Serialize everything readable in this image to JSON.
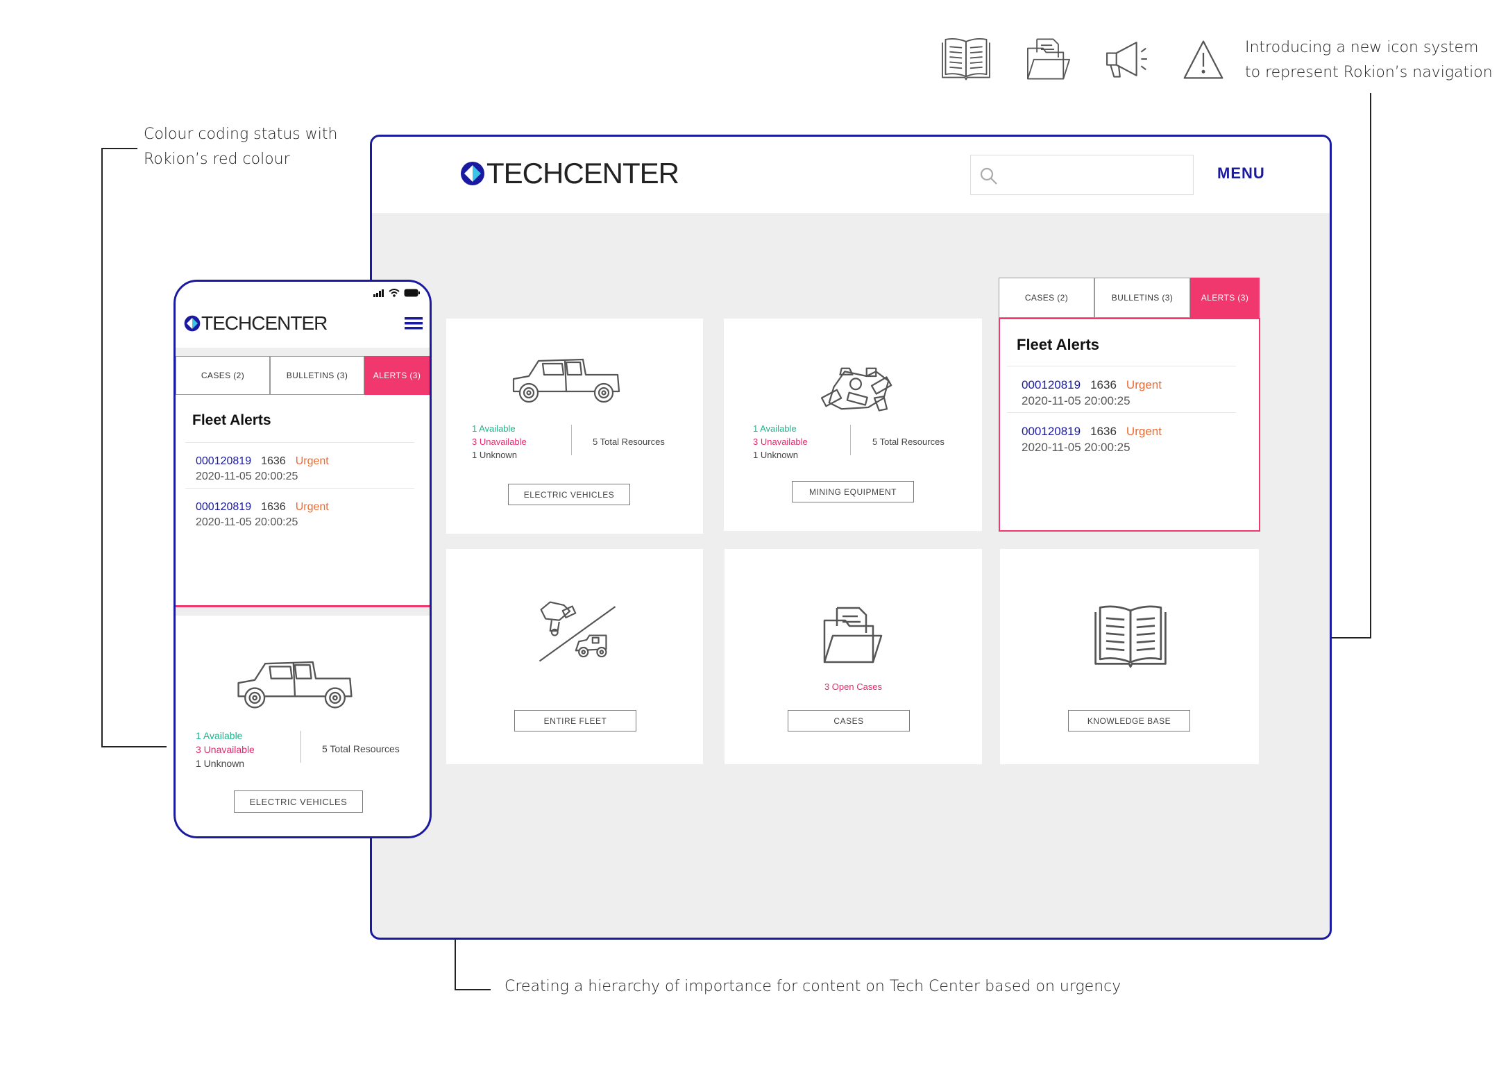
{
  "annotations": {
    "top_right": [
      "Introducing a new icon system",
      "to represent Rokion’s navigation"
    ],
    "left": [
      "Colour coding status with",
      "Rokion’s red colour"
    ],
    "bottom": "Creating a hierarchy of importance for content on Tech Center based on urgency"
  },
  "icon_legend": [
    "book-icon",
    "folder-icon",
    "megaphone-icon",
    "warning-icon"
  ],
  "brand": {
    "logo_text": "TECHCENTER",
    "accent": "#1a1aa0",
    "alert": "#f0386e",
    "available": "#1fb38a",
    "urgent": "#f06a30"
  },
  "desktop": {
    "search": {
      "placeholder": ""
    },
    "menu_label": "MENU",
    "cards": {
      "ev": {
        "available": "1 Available",
        "unavailable": "3 Unavailable",
        "unknown": "1 Unknown",
        "total": "5 Total Resources",
        "button": "ELECTRIC VEHICLES"
      },
      "mining": {
        "available": "1 Available",
        "unavailable": "3 Unavailable",
        "unknown": "1 Unknown",
        "total": "5 Total Resources",
        "button": "MINING EQUIPMENT"
      },
      "fleet": {
        "button": "ENTIRE FLEET"
      },
      "cases": {
        "status": "3 Open Cases",
        "button": "CASES"
      },
      "kb": {
        "button": "KNOWLEDGE BASE"
      }
    },
    "tabs": [
      "CASES (2)",
      "BULLETINS (3)",
      "ALERTS (3)"
    ],
    "alerts": {
      "title": "Fleet Alerts",
      "items": [
        {
          "id": "000120819",
          "num": "1636",
          "priority": "Urgent",
          "timestamp": "2020-11-05 20:00:25"
        },
        {
          "id": "000120819",
          "num": "1636",
          "priority": "Urgent",
          "timestamp": "2020-11-05 20:00:25"
        }
      ]
    }
  },
  "mobile": {
    "tabs": [
      "CASES (2)",
      "BULLETINS (3)",
      "ALERTS (3)"
    ],
    "alerts": {
      "title": "Fleet Alerts",
      "items": [
        {
          "id": "000120819",
          "num": "1636",
          "priority": "Urgent",
          "timestamp": "2020-11-05 20:00:25"
        },
        {
          "id": "000120819",
          "num": "1636",
          "priority": "Urgent",
          "timestamp": "2020-11-05 20:00:25"
        }
      ]
    },
    "ev": {
      "available": "1 Available",
      "unavailable": "3 Unavailable",
      "unknown": "1 Unknown",
      "total": "5 Total Resources",
      "button": "ELECTRIC VEHICLES"
    }
  }
}
